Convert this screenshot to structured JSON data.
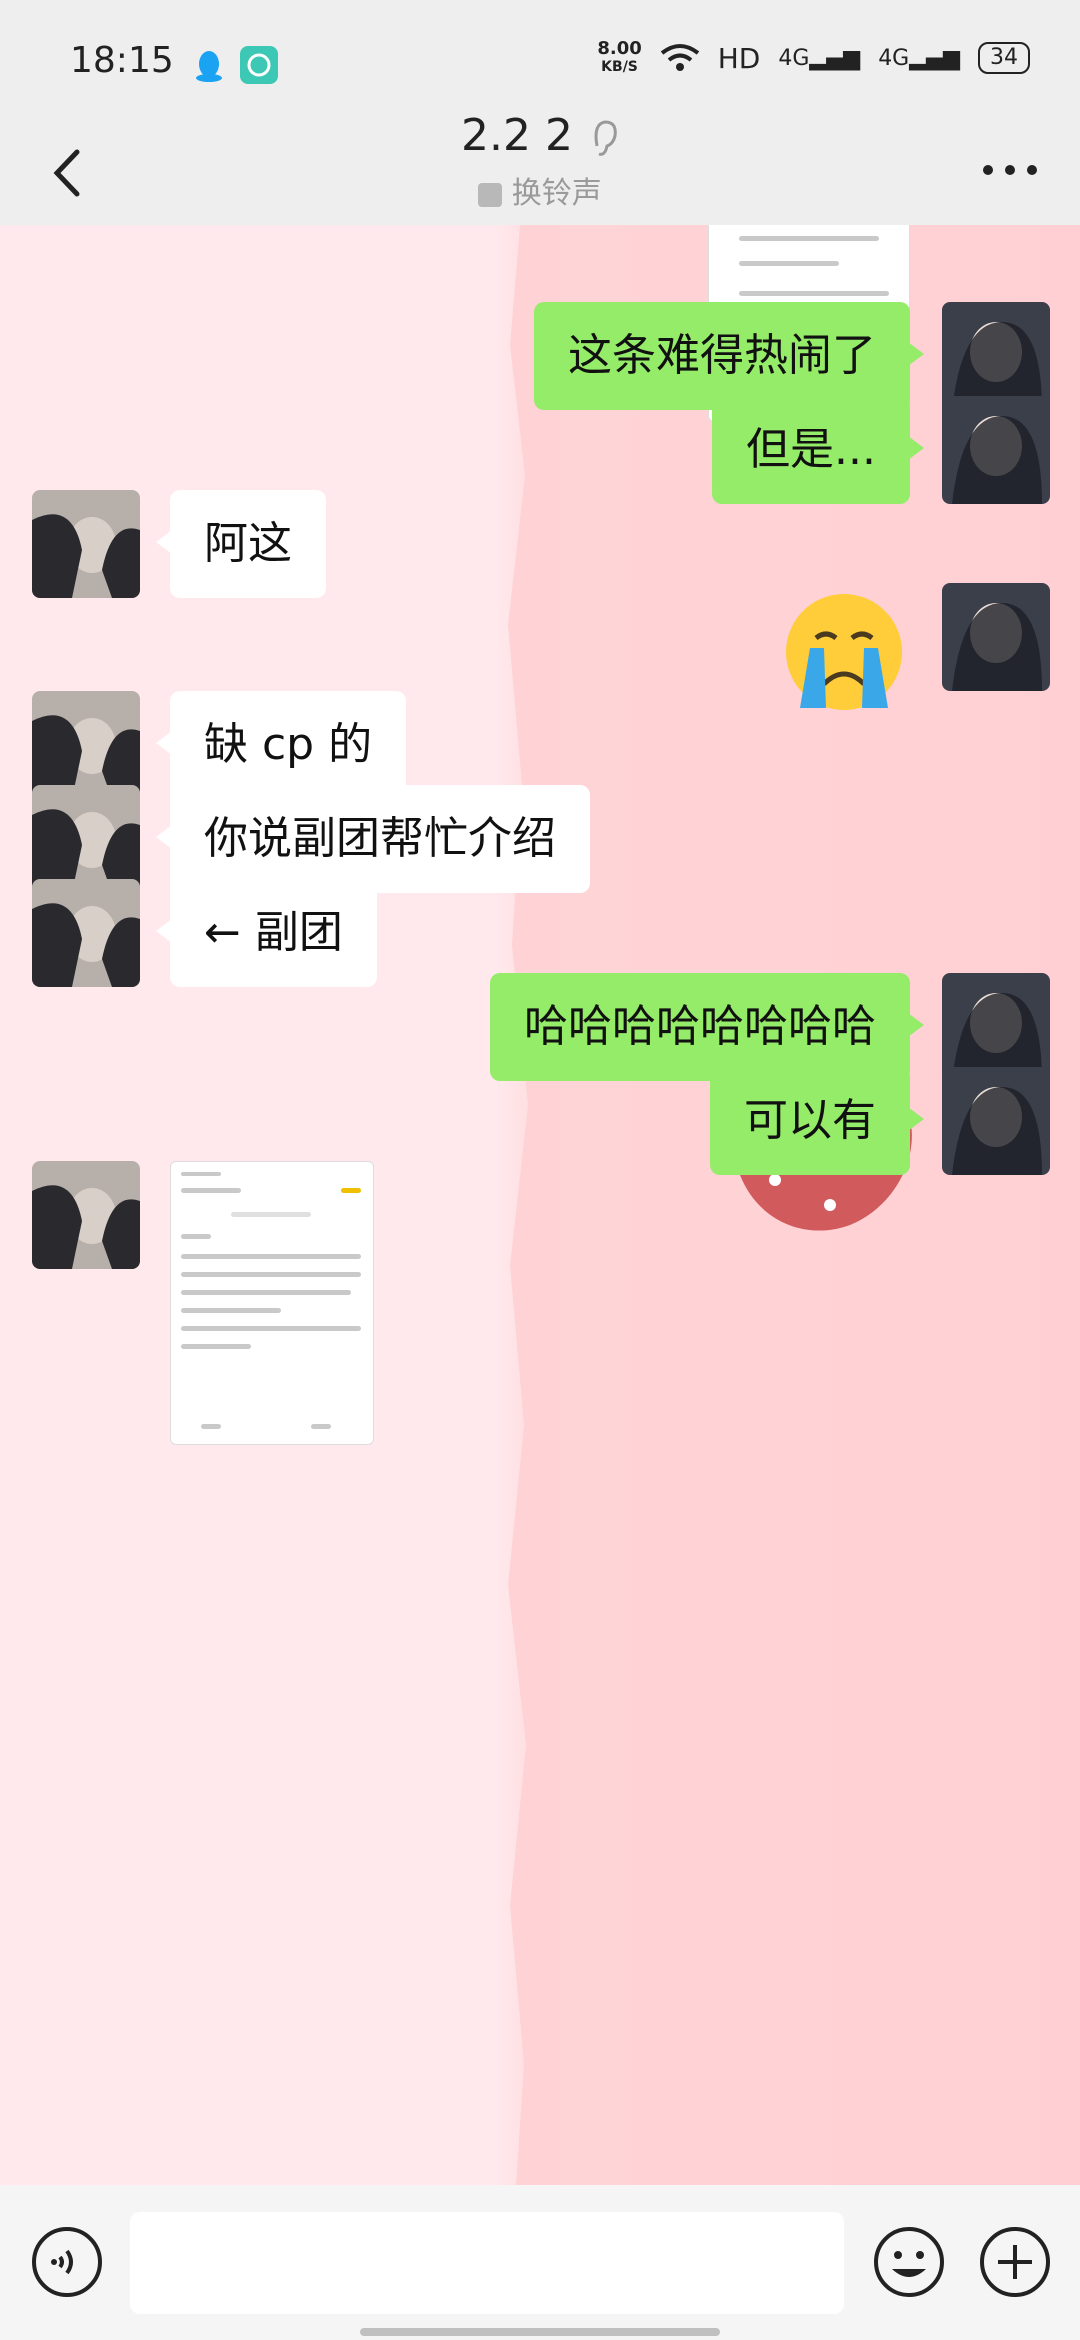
{
  "status_bar": {
    "time": "18:15",
    "netspeed_value": "8.00",
    "netspeed_unit": "KB/S",
    "hd_label": "HD",
    "signal1": "4G",
    "signal2": "4G",
    "battery": "34"
  },
  "header": {
    "title": "2.2 2",
    "subtitle": "换铃声"
  },
  "messages": [
    {
      "side": "out",
      "text": "这条难得热闹了"
    },
    {
      "side": "out",
      "text": "但是..."
    },
    {
      "side": "in",
      "text": "阿这"
    },
    {
      "side": "out",
      "emoji": "crying-face"
    },
    {
      "side": "in",
      "text": "缺 cp 的"
    },
    {
      "side": "in",
      "text": "你说副团帮忙介绍"
    },
    {
      "side": "in",
      "text": "← 副团"
    },
    {
      "side": "out",
      "text": "哈哈哈哈哈哈哈哈"
    },
    {
      "side": "out",
      "text": "可以有"
    },
    {
      "side": "in",
      "image": "screenshot"
    }
  ],
  "colors": {
    "out_bubble": "#95ec69",
    "in_bubble": "#ffffff",
    "bar_background": "#eeeeee"
  }
}
